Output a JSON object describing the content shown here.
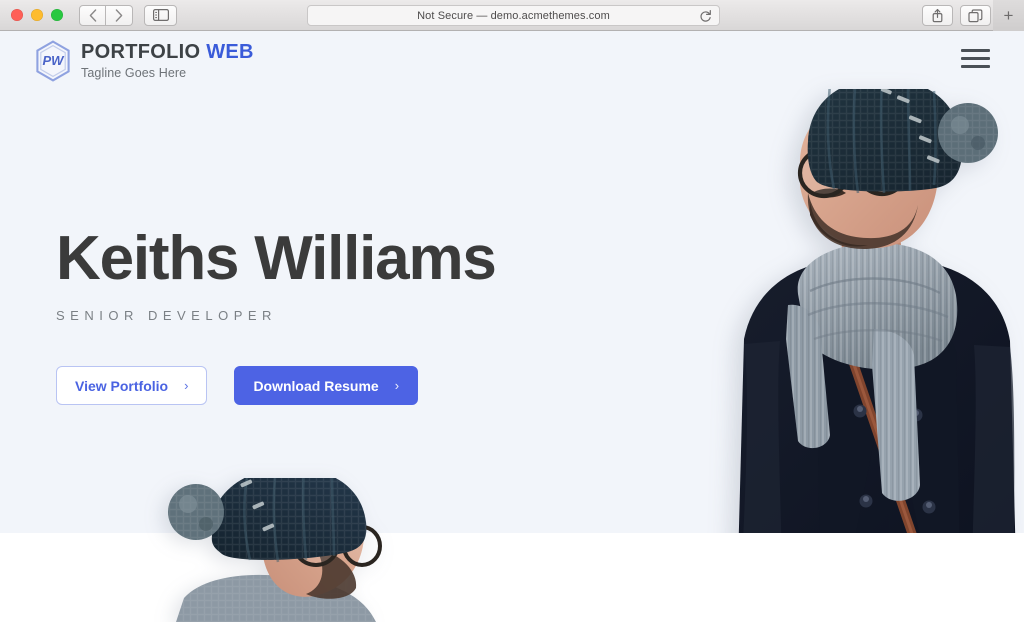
{
  "browser": {
    "traffic_lights": [
      "close",
      "minimize",
      "maximize"
    ],
    "back_label": "‹",
    "forward_label": "›",
    "sidebar_icon": "sidebar-icon",
    "url_text": "Not Secure — demo.acmethemes.com",
    "reload_icon": "reload-icon",
    "share_icon": "share-icon",
    "tabs_icon": "tabs-overview-icon",
    "new_tab_label": "+"
  },
  "site": {
    "logo": {
      "monogram": "PW",
      "title_main": "PORTFOLIO",
      "title_accent": "WEB",
      "tagline": "Tagline Goes Here"
    },
    "menu_toggle_label": "menu"
  },
  "hero": {
    "name": "Keiths Williams",
    "role": "SENIOR DEVELOPER",
    "buttons": [
      {
        "label": "View Portfolio",
        "chevron": "›",
        "style": "outline"
      },
      {
        "label": "Download Resume",
        "chevron": "›",
        "style": "filled"
      }
    ],
    "background_color": "#f2f5fa"
  },
  "colors": {
    "accent_blue": "#4d63e4",
    "logo_blue": "#3a5bd9",
    "heading_dark": "#3b3b3b",
    "muted_text": "#7b8085",
    "hero_bg": "#f2f5fa",
    "page_bg": "#ffffff"
  },
  "images": {
    "primary_photo_alt": "portrait-man-beanie-scarf-right",
    "secondary_photo_alt": "portrait-man-beanie-scarf-left"
  }
}
